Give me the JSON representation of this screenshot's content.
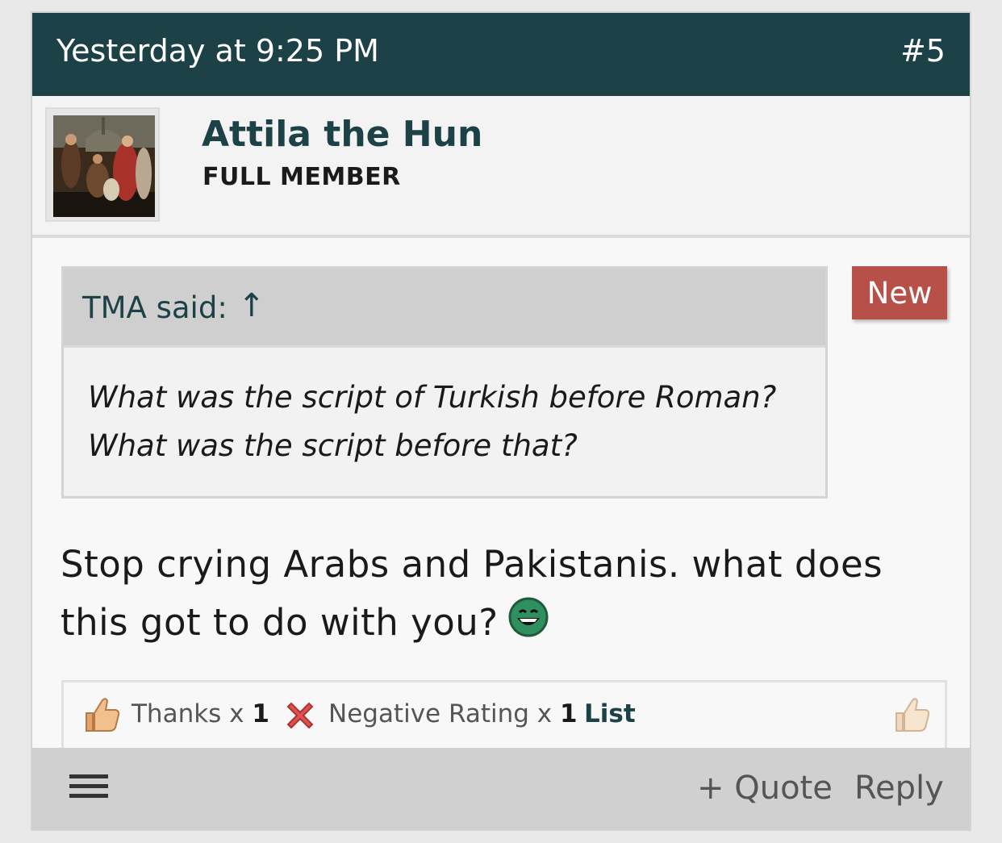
{
  "post": {
    "date": "Yesterday at 9:25 PM",
    "number": "#5"
  },
  "author": {
    "name": "Attila the Hun",
    "rank": "FULL MEMBER"
  },
  "quote": {
    "author": "TMA said:",
    "arrow": "↑",
    "text": "What was the script of Turkish before Roman? What was the script before that?"
  },
  "badge": {
    "label": "New",
    "color": "#b8504a"
  },
  "message": {
    "text": "Stop crying Arabs and Pakistanis. what does this got to do with you?",
    "emoji": "grin-icon"
  },
  "reactions": {
    "thanks_label": "Thanks x",
    "thanks_count": "1",
    "negative_label": "Negative Rating x",
    "negative_count": "1",
    "list_label": "List"
  },
  "footer": {
    "quote_label": "+ Quote",
    "reply_label": "Reply"
  },
  "colors": {
    "header_bg": "#1c4147",
    "accent": "#1c4147",
    "footer_bg": "#d0d0d0"
  }
}
